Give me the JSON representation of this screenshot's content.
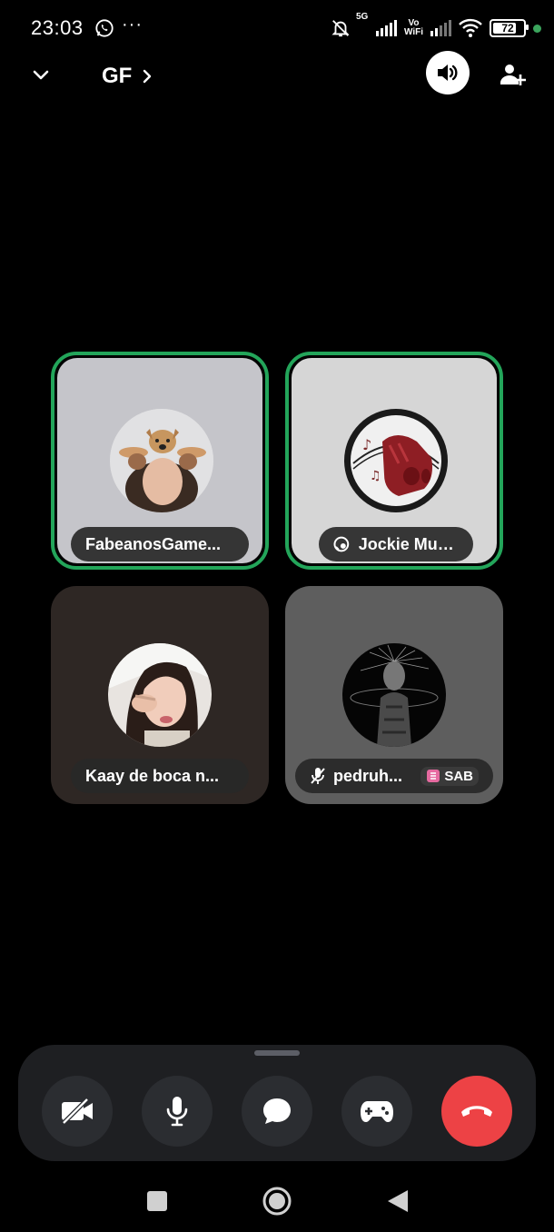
{
  "status_bar": {
    "time": "23:03",
    "notifications": [
      "whatsapp-icon",
      "more-dots"
    ],
    "more": "···",
    "network_label": "5G",
    "vowifi_label_top": "Vo",
    "vowifi_label_bottom": "WiFi",
    "battery_level": "72"
  },
  "header": {
    "channel_name": "GF"
  },
  "participants": [
    {
      "name": "FabeanosGame...",
      "speaking": true,
      "muted": false
    },
    {
      "name": "Jockie Music",
      "speaking": true,
      "muted": false,
      "status_icon": "headset-icon"
    },
    {
      "name": "Kaay de boca n...",
      "speaking": false,
      "muted": false
    },
    {
      "name": "pedruh...",
      "speaking": false,
      "muted": true,
      "badge": "SAB"
    }
  ],
  "controls": [
    {
      "name": "camera-off-button",
      "icon": "video-off-icon"
    },
    {
      "name": "microphone-button",
      "icon": "microphone-icon"
    },
    {
      "name": "chat-button",
      "icon": "chat-bubble-icon"
    },
    {
      "name": "activities-button",
      "icon": "gamepad-icon"
    },
    {
      "name": "disconnect-button",
      "icon": "hang-up-icon"
    }
  ],
  "colors": {
    "speaking_ring": "#23a55a",
    "end_call": "#ed4245",
    "control_bar": "#1e1f22",
    "control_button": "#2b2d31"
  }
}
